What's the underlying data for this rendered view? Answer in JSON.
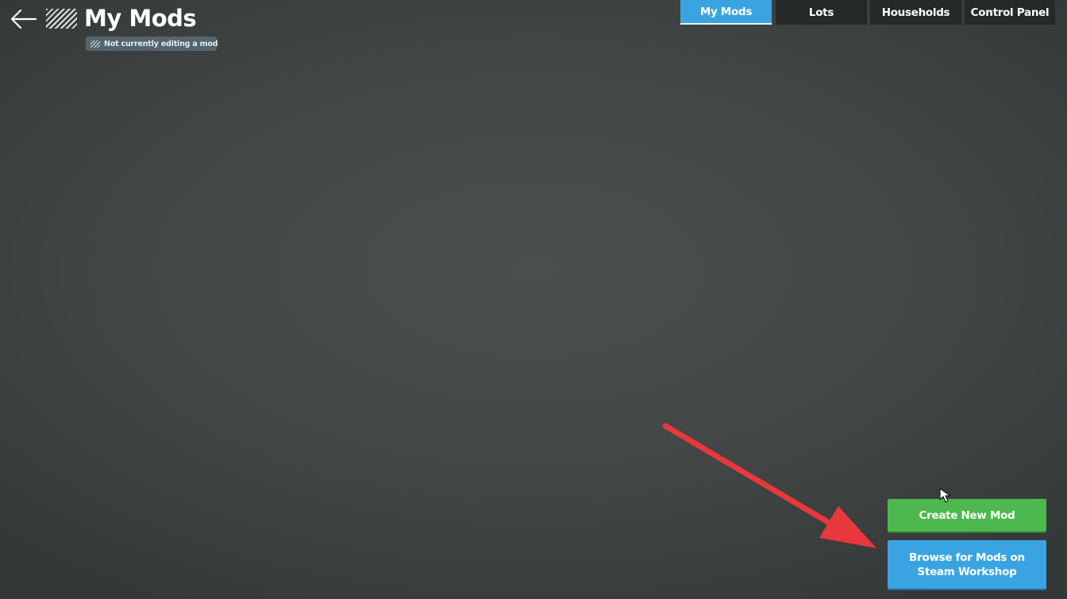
{
  "header": {
    "back_icon": "back-arrow-icon",
    "title": "My Mods",
    "title_icon": "striped-mod-icon",
    "status_badge": "Not currently editing a mod"
  },
  "tabs": [
    {
      "label": "My Mods",
      "active": true
    },
    {
      "label": "Lots",
      "active": false
    },
    {
      "label": "Households",
      "active": false
    },
    {
      "label": "Control Panel",
      "active": false
    }
  ],
  "actions": {
    "create_label": "Create New Mod",
    "browse_label": "Browse for Mods on Steam Workshop"
  },
  "colors": {
    "background": "#424645",
    "tab_active": "#3aa4e3",
    "tab_inactive": "#262929",
    "create_button": "#4db84d",
    "browse_button": "#3aa4e3",
    "annotation_arrow": "#e8383b"
  }
}
